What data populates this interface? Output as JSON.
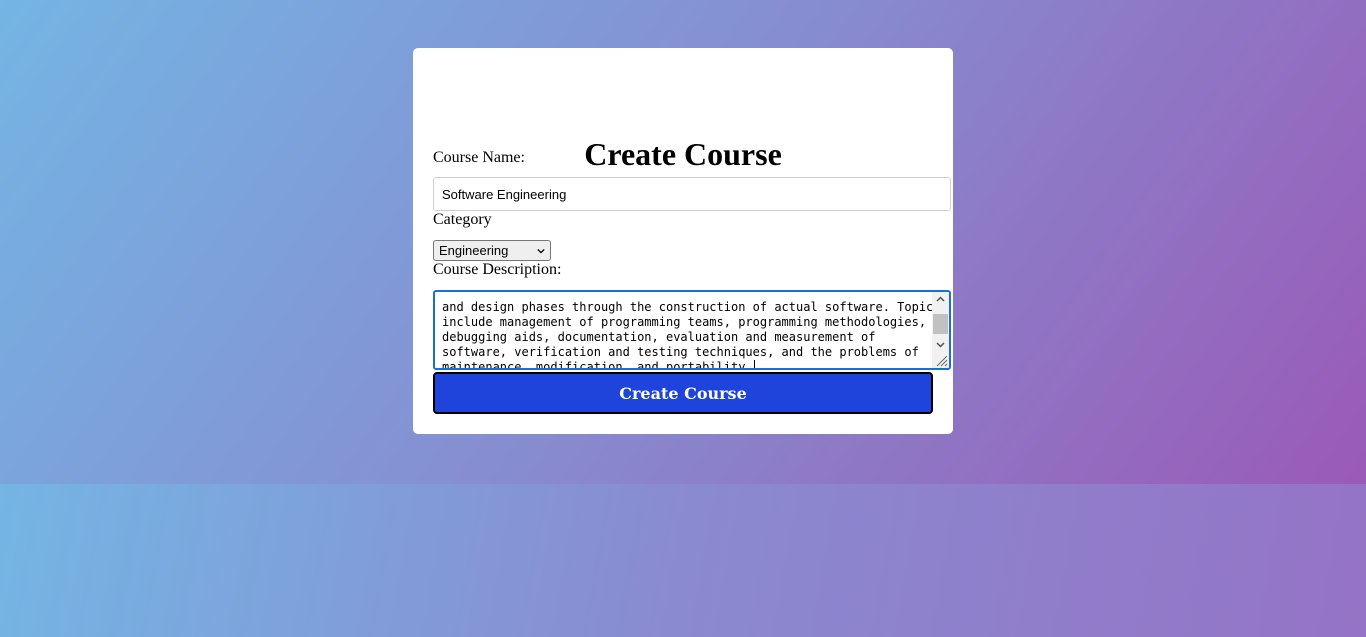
{
  "page": {
    "title": "Create Course"
  },
  "form": {
    "course_name_label": "Course Name:",
    "course_name_value": "Software Engineering",
    "category_label": "Category",
    "category_selected": "Engineering",
    "description_label": "Course Description:",
    "description_lines": [
      "and design phases through the construction of actual software. Topics",
      "include management of programming teams, programming methodologies,",
      "debugging aids, documentation, evaluation and measurement of",
      "software, verification and testing techniques, and the problems of",
      "maintenance, modification, and portability."
    ],
    "submit_label": "Create Course"
  },
  "colors": {
    "button_bg": "#1f44dc",
    "focus_border": "#1a6fd6"
  },
  "icons": {
    "select_arrow": "chevron-down-icon",
    "scroll_up": "chevron-up-icon",
    "scroll_down": "chevron-down-icon",
    "resize": "resize-grip-icon"
  }
}
